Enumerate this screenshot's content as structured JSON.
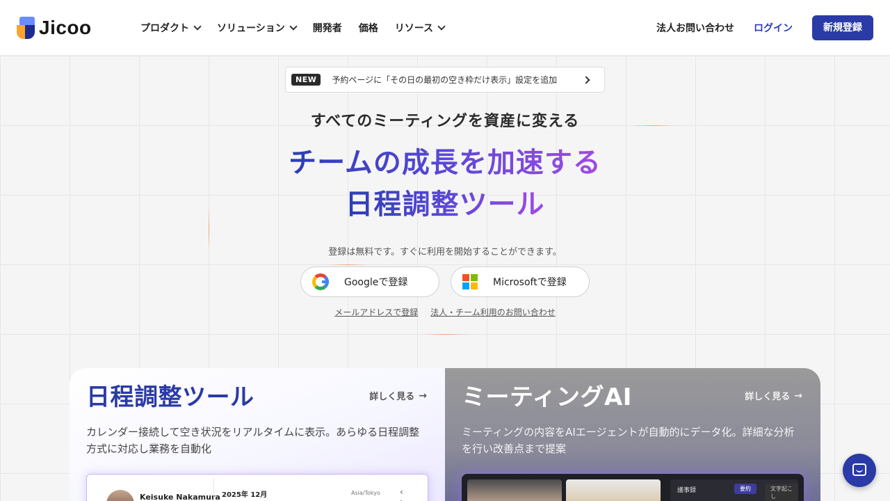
{
  "header": {
    "logo_text": "Jicoo",
    "nav": [
      {
        "label": "プロダクト",
        "dropdown": true
      },
      {
        "label": "ソリューション",
        "dropdown": true
      },
      {
        "label": "開発者",
        "dropdown": false
      },
      {
        "label": "価格",
        "dropdown": false
      },
      {
        "label": "リソース",
        "dropdown": true
      }
    ],
    "contact_label": "法人お問い合わせ",
    "login_label": "ログイン",
    "signup_label": "新規登録"
  },
  "news": {
    "badge": "NEW",
    "text": "予約ページに「その日の最初の空き枠だけ表示」設定を追加"
  },
  "hero": {
    "eyebrow": "すべてのミーティングを資産に変える",
    "title_line1": "チームの成長を加速する",
    "title_line2": "日程調整ツール",
    "subtitle": "登録は無料です。すぐに利用を開始することができます。",
    "google_label": "Googleで登録",
    "microsoft_label": "Microsoftで登録",
    "email_link": "メールアドレスで登録",
    "contact_link": "法人・チーム利用のお問い合わせ"
  },
  "cards": {
    "left": {
      "title": "日程調整ツール",
      "more": "詳しく見る",
      "desc": "カレンダー接続して空き状況をリアルタイムに表示。あらゆる日程調整方式に対応し業務を自動化",
      "preview": {
        "name": "Keisuke Nakamura",
        "month": "2025年 12月",
        "timezone": "Asia/Tokyo",
        "nav": "‹ ›"
      }
    },
    "right": {
      "title": "ミーティングAI",
      "more": "詳しく見る",
      "desc": "ミーティングの内容をAIエージェントが自動的にデータ化。詳細な分析を行い改善点まで提案",
      "preview": {
        "panel_title": "議事録",
        "tab1": "要約",
        "tab2": "文字起こし"
      }
    }
  },
  "colors": {
    "brand": "#2a3aa6",
    "gradient_start": "#2a3db5",
    "gradient_end": "#a24ae6"
  }
}
